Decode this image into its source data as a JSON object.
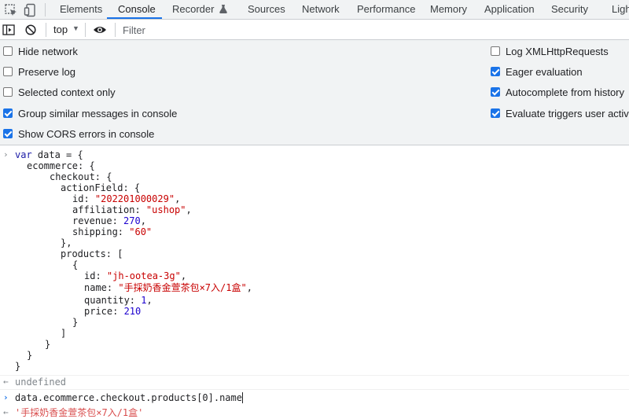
{
  "tabs": [
    "Elements",
    "Console",
    "Recorder",
    "Sources",
    "Network",
    "Performance",
    "Memory",
    "Application",
    "Security",
    "Ligh"
  ],
  "toolbar": {
    "context": "top",
    "filter_placeholder": "Filter"
  },
  "settings": {
    "left": [
      {
        "label": "Hide network",
        "checked": false
      },
      {
        "label": "Preserve log",
        "checked": false
      },
      {
        "label": "Selected context only",
        "checked": false
      },
      {
        "label": "Group similar messages in console",
        "checked": true
      },
      {
        "label": "Show CORS errors in console",
        "checked": true
      }
    ],
    "right": [
      {
        "label": "Log XMLHttpRequests",
        "checked": false
      },
      {
        "label": "Eager evaluation",
        "checked": true
      },
      {
        "label": "Autocomplete from history",
        "checked": true
      },
      {
        "label": "Evaluate triggers user activati",
        "checked": true
      }
    ]
  },
  "console": {
    "code": {
      "l1_kw": "var",
      "l1_rest": " data = {",
      "l2": "ecommerce: {",
      "l3": "checkout: {",
      "l4": "actionField: {",
      "l5_key": "id: ",
      "l5_val": "\"202201000029\"",
      "l6_key": "affiliation: ",
      "l6_val": "\"ushop\"",
      "l7_key": "revenue: ",
      "l7_val": "270",
      "l8_key": "shipping: ",
      "l8_val": "\"60\"",
      "l9": "},",
      "l10": "products: [",
      "l11": "{",
      "l12_key": "id: ",
      "l12_val": "\"jh-ootea-3g\"",
      "l13_key": "name: ",
      "l13_val": "\"手採奶香金萱茶包×7入/1盒\"",
      "l14_key": "quantity: ",
      "l14_val": "1",
      "l15_key": "price: ",
      "l15_val": "210",
      "l16": "}",
      "l17": "]",
      "l18": "}",
      "l19": "}",
      "l20": "}"
    },
    "result1": "undefined",
    "input2": "data.ecommerce.checkout.products[0].name",
    "result2": "'手採奶香金萱茶包×7入/1盒'"
  }
}
